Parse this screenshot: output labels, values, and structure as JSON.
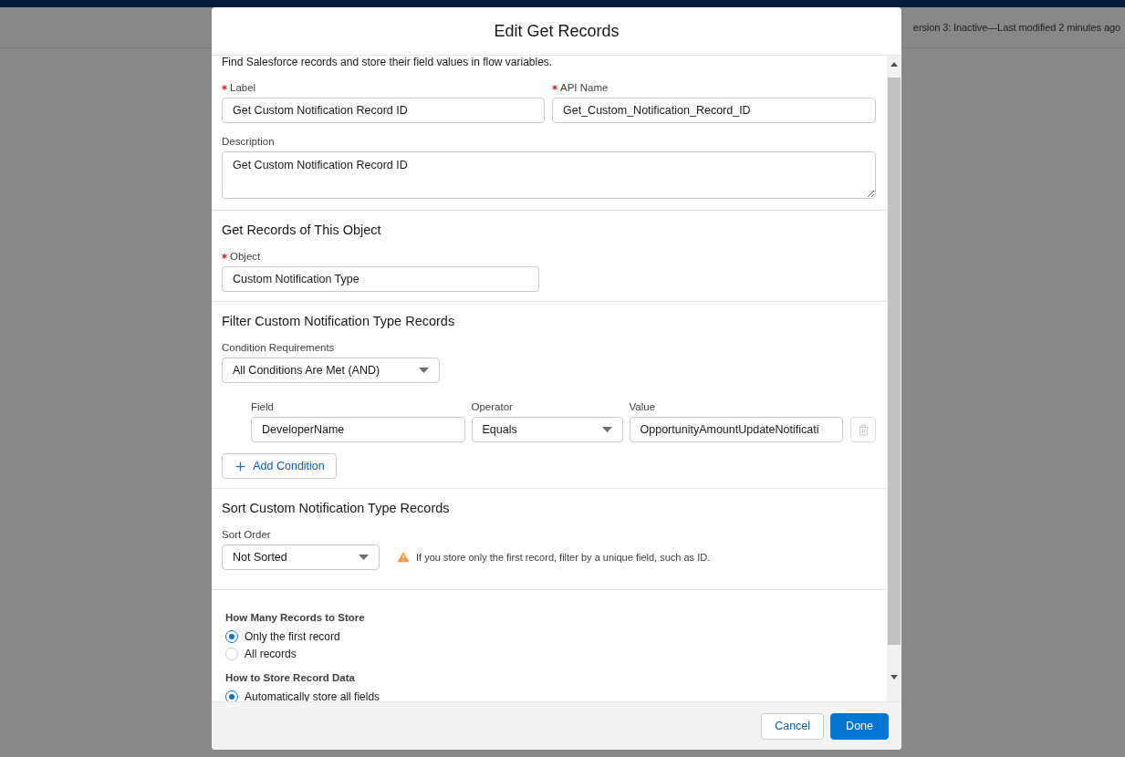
{
  "background": {
    "status": "ersion 3: Inactive—Last modified 2 minutes ago"
  },
  "dialog": {
    "title": "Edit Get Records",
    "intro": "Find Salesforce records and store their field values in flow variables.",
    "label_field": {
      "label": "Label",
      "required": true,
      "value": "Get Custom Notification Record ID"
    },
    "api_name_field": {
      "label": "API Name",
      "required": true,
      "value": "Get_Custom_Notification_Record_ID"
    },
    "description_field": {
      "label": "Description",
      "value": "Get Custom Notification Record ID"
    },
    "object_section": {
      "title": "Get Records of This Object",
      "field": {
        "label": "Object",
        "required": true,
        "value": "Custom Notification Type"
      }
    },
    "filter_section": {
      "title": "Filter Custom Notification Type Records",
      "requirements": {
        "label": "Condition Requirements",
        "value": "All Conditions Are Met (AND)"
      },
      "condition": {
        "field_label": "Field",
        "field_value": "DeveloperName",
        "operator_label": "Operator",
        "operator_value": "Equals",
        "value_label": "Value",
        "value_value": "OpportunityAmountUpdateNotificati",
        "delete_disabled": true
      },
      "add_button": "Add Condition"
    },
    "sort_section": {
      "title": "Sort Custom Notification Type Records",
      "sort_label": "Sort Order",
      "sort_value": "Not Sorted",
      "warning": "If you store only the first record, filter by a unique field, such as ID."
    },
    "radio_groups": [
      {
        "title": "How Many Records to Store",
        "options": [
          {
            "label": "Only the first record",
            "selected": true
          },
          {
            "label": "All records",
            "selected": false
          }
        ]
      },
      {
        "title": "How to Store Record Data",
        "options": [
          {
            "label": "Automatically store all fields",
            "selected": true
          }
        ]
      }
    ],
    "buttons": {
      "cancel": "Cancel",
      "done": "Done"
    }
  }
}
